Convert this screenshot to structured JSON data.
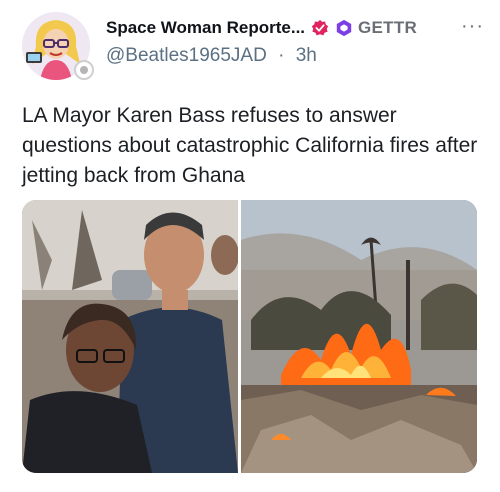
{
  "post": {
    "display_name": "Space Woman Reporte...",
    "network_label": "GETTR",
    "handle": "@Beatles1965JAD",
    "separator": "·",
    "time_ago": "3h",
    "text": "LA Mayor Karen Bass refuses to answer questions about catastrophic California fires after jetting back from Ghana"
  },
  "icons": {
    "avatar": "cartoon-woman-avatar",
    "verified": "red-verified-badge-icon",
    "network": "gettr-hexagon-icon",
    "more": "more-options-icon"
  },
  "colors": {
    "verified": "#e0245e",
    "gettr_purple": "#7b3fe4",
    "secondary_text": "#5b7083",
    "fire": "#ff7a1a"
  }
}
